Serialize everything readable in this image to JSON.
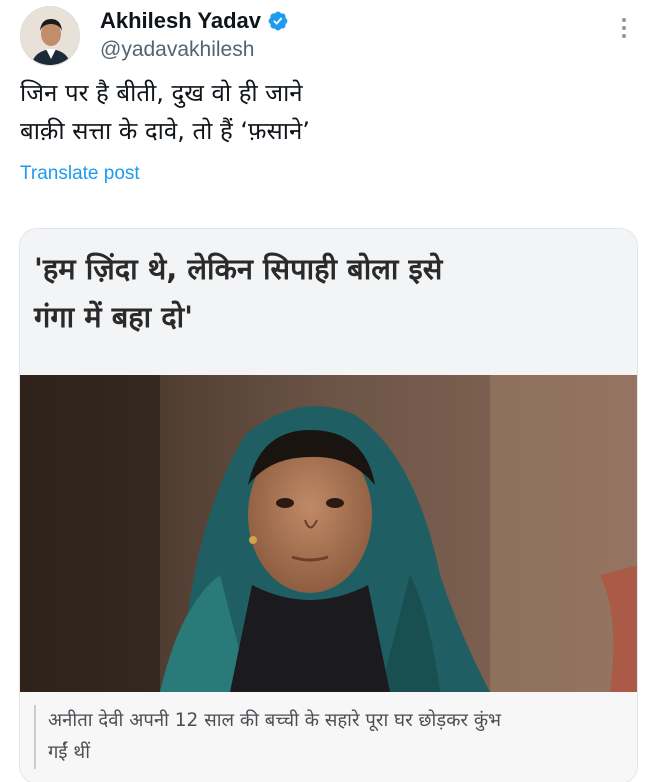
{
  "author": {
    "display_name": "Akhilesh Yadav",
    "handle": "@yadavakhilesh",
    "verified": true,
    "avatar_icon": "profile-photo",
    "verified_icon": "verified-badge-icon",
    "more_icon": "more-options-icon"
  },
  "tweet": {
    "text_lines": [
      "जिन पर है बीती, दुख वो ही जाने",
      "बाक़ी सत्ता के दावे, तो हैं ‘फ़साने’"
    ],
    "translate_label": "Translate post"
  },
  "card": {
    "headline_lines": [
      "'हम ज़िंदा थे, लेकिन सिपाही बोला इसे",
      "गंगा में बहा दो'"
    ],
    "image_icon": "woman-portrait-photo",
    "caption_lines": [
      "अनीता देवी अपनी 12 साल की बच्ची के सहारे पूरा घर छोड़कर कुंभ",
      "गईं थीं"
    ]
  },
  "colors": {
    "link": "#1d9bf0",
    "verified": "#1d9bf0",
    "secondary_text": "#536471",
    "primary_text": "#0f1419"
  }
}
